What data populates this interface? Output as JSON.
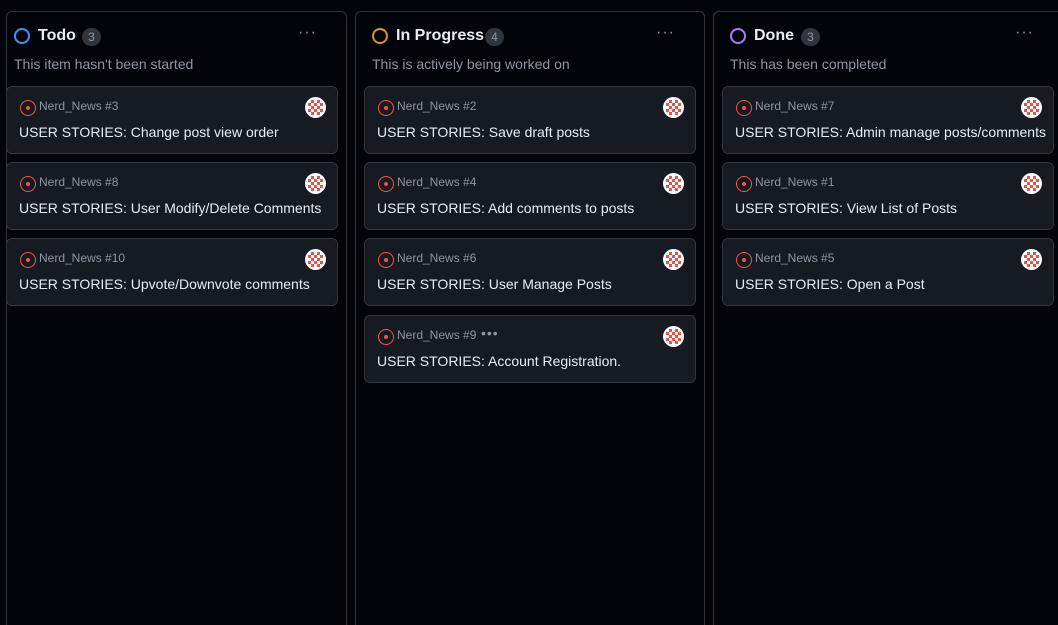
{
  "accent_colors": {
    "todo": "#4493f8",
    "in_progress": "#d29922",
    "done": "#ab7df8",
    "issue_open": "#f85149",
    "avatar": "#e5534b"
  },
  "columns": [
    {
      "title": "Todo",
      "count": "3",
      "description": "This item hasn't been started",
      "more_icon": "kebab-horizontal-icon",
      "cards": [
        {
          "ref": "Nerd_News #3",
          "title": "USER STORIES: Change post view order"
        },
        {
          "ref": "Nerd_News #8",
          "title": "USER STORIES: User Modify/Delete Comments"
        },
        {
          "ref": "Nerd_News #10",
          "title": "USER STORIES: Upvote/Downvote comments"
        }
      ]
    },
    {
      "title": "In Progress",
      "count": "4",
      "description": "This is actively being worked on",
      "more_icon": "kebab-horizontal-icon",
      "cards": [
        {
          "ref": "Nerd_News #2",
          "title": "USER STORIES: Save draft posts"
        },
        {
          "ref": "Nerd_News #4",
          "title": "USER STORIES: Add comments to posts"
        },
        {
          "ref": "Nerd_News #6",
          "title": "USER STORIES: User Manage Posts"
        },
        {
          "ref": "Nerd_News #9",
          "title": "USER STORIES: Account Registration.",
          "more": "•••"
        }
      ]
    },
    {
      "title": "Done",
      "count": "3",
      "description": "This has been completed",
      "more_icon": "kebab-horizontal-icon",
      "cards": [
        {
          "ref": "Nerd_News #7",
          "title": "USER STORIES: Admin manage posts/comments"
        },
        {
          "ref": "Nerd_News #1",
          "title": "USER STORIES: View List of Posts"
        },
        {
          "ref": "Nerd_News #5",
          "title": "USER STORIES: Open a Post"
        }
      ]
    }
  ],
  "more_label": "···"
}
